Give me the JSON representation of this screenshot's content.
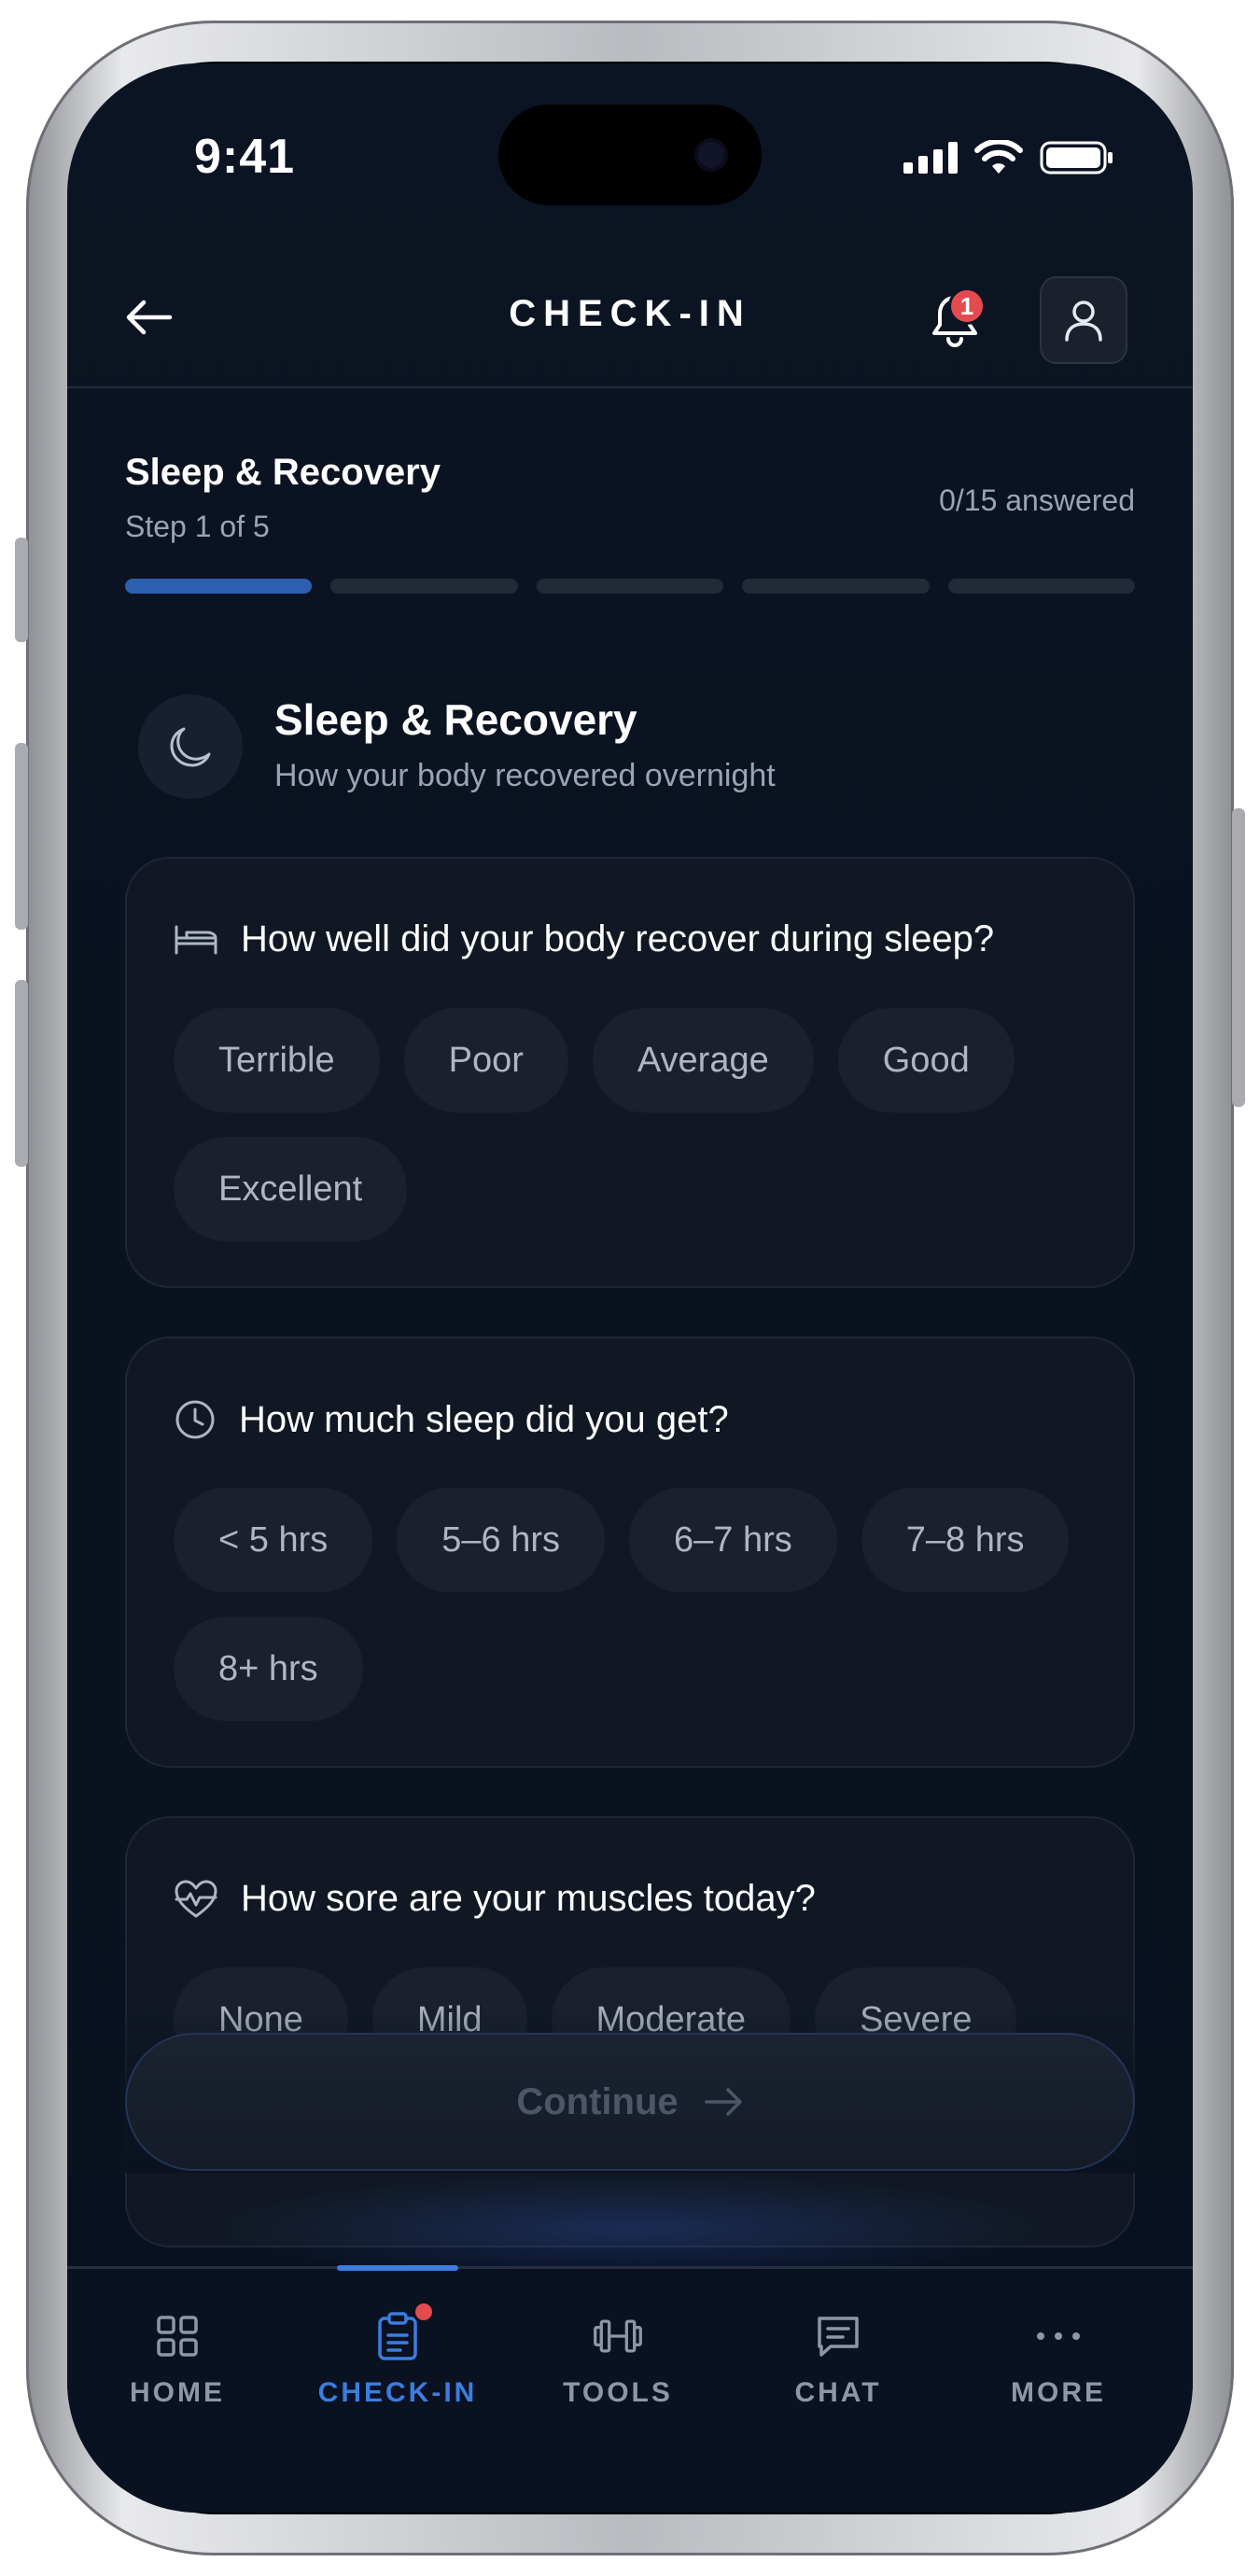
{
  "status_bar": {
    "time": "9:41"
  },
  "header": {
    "title": "CHECK-IN",
    "notification_count": "1"
  },
  "progress": {
    "section_title": "Sleep & Recovery",
    "step_label": "Step 1 of 5",
    "answered_label": "0/15 answered",
    "current_step": 1,
    "total_steps": 5
  },
  "category": {
    "title": "Sleep & Recovery",
    "subtitle": "How your body recovered overnight",
    "icon": "moon-icon"
  },
  "questions": [
    {
      "icon": "bed-icon",
      "text": "How well did your body recover during sleep?",
      "options": [
        "Terrible",
        "Poor",
        "Average",
        "Good",
        "Excellent"
      ]
    },
    {
      "icon": "clock-icon",
      "text": "How much sleep did you get?",
      "options": [
        "< 5 hrs",
        "5–6 hrs",
        "6–7 hrs",
        "7–8 hrs",
        "8+ hrs"
      ]
    },
    {
      "icon": "heart-pulse-icon",
      "text": "How sore are your muscles today?",
      "options": [
        "None",
        "Mild",
        "Moderate",
        "Severe"
      ]
    }
  ],
  "continue_button": {
    "label": "Continue"
  },
  "tabbar": {
    "active": "CHECK-IN",
    "tabs": [
      {
        "label": "HOME",
        "icon": "grid-icon"
      },
      {
        "label": "CHECK-IN",
        "icon": "clipboard-icon"
      },
      {
        "label": "TOOLS",
        "icon": "dumbbell-icon"
      },
      {
        "label": "CHAT",
        "icon": "chat-icon"
      },
      {
        "label": "MORE",
        "icon": "more-dots-icon"
      }
    ]
  },
  "colors": {
    "background": "#0a1220",
    "card": "#111824",
    "chip": "#1a212d",
    "accent": "#3b7de0",
    "progress_active": "#2c5fb0",
    "badge": "#e44b4f"
  }
}
